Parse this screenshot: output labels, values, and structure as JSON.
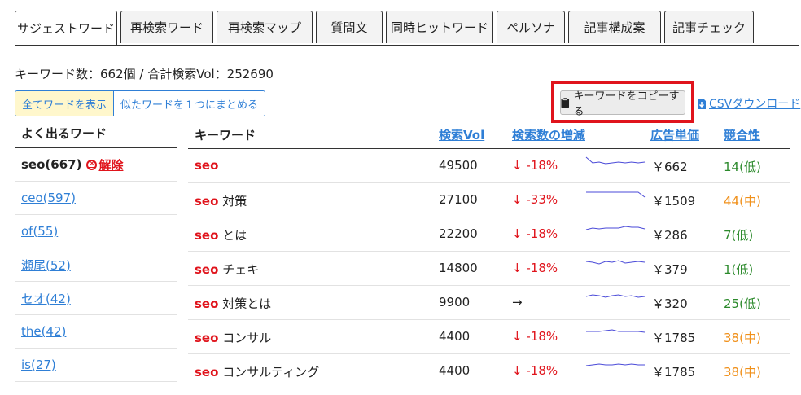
{
  "tabs": [
    "サジェストワード",
    "再検索ワード",
    "再検索マップ",
    "質問文",
    "同時ヒットワード",
    "ペルソナ",
    "記事構成案",
    "記事チェック"
  ],
  "summary": "キーワード数：662個 / 合計検索Vol：252690",
  "buttons": {
    "show_all": "全てワードを表示",
    "group_similar": "似たワードを１つにまとめる",
    "copy_keywords": "キーワードをコピーする",
    "csv_download": "CSVダウンロード"
  },
  "freq": {
    "header": "よく出るワード",
    "current": "seo(667)",
    "clear_label": "解除",
    "items": [
      "ceo(597)",
      "of(55)",
      "瀬尾(52)",
      "セオ(42)",
      "the(42)",
      "is(27)"
    ]
  },
  "table": {
    "headers": {
      "keyword": "キーワード",
      "volume": "検索Vol",
      "trend": "検索数の増減",
      "cpc": "広告単価",
      "competition": "競合性"
    },
    "accent": "#e0141c",
    "rows": [
      {
        "seo": "seo",
        "rest": "",
        "vol": "49500",
        "arrow": "↓",
        "change": "-18%",
        "cpc": "￥662",
        "comp": "14(低)",
        "level": "low",
        "spark": [
          2,
          9,
          8,
          10,
          9,
          8,
          9,
          8,
          9,
          8
        ]
      },
      {
        "seo": "seo",
        "rest": " 対策",
        "vol": "27100",
        "arrow": "↓",
        "change": "-33%",
        "cpc": "￥1509",
        "comp": "44(中)",
        "level": "mid",
        "spark": [
          3,
          3,
          3,
          3,
          3,
          3,
          3,
          3,
          3,
          9
        ]
      },
      {
        "seo": "seo",
        "rest": " とは",
        "vol": "22200",
        "arrow": "↓",
        "change": "-18%",
        "cpc": "￥286",
        "comp": "7(低)",
        "level": "low",
        "spark": [
          7,
          5,
          6,
          5,
          5,
          5,
          3,
          4,
          4,
          6
        ]
      },
      {
        "seo": "seo",
        "rest": " チェキ",
        "vol": "14800",
        "arrow": "↓",
        "change": "-18%",
        "cpc": "￥379",
        "comp": "1(低)",
        "level": "low",
        "spark": [
          4,
          5,
          7,
          4,
          5,
          3,
          6,
          5,
          4,
          5
        ]
      },
      {
        "seo": "seo",
        "rest": " 対策とは",
        "vol": "9900",
        "arrow": "→",
        "change": "",
        "cpc": "￥320",
        "comp": "25(低)",
        "level": "low",
        "spark": [
          5,
          3,
          4,
          6,
          4,
          3,
          5,
          4,
          6,
          5
        ]
      },
      {
        "seo": "seo",
        "rest": " コンサル",
        "vol": "4400",
        "arrow": "↓",
        "change": "-18%",
        "cpc": "￥1785",
        "comp": "38(中)",
        "level": "mid",
        "spark": [
          6,
          6,
          6,
          5,
          4,
          6,
          6,
          6,
          6,
          7
        ]
      },
      {
        "seo": "seo",
        "rest": " コンサルティング",
        "vol": "4400",
        "arrow": "↓",
        "change": "-18%",
        "cpc": "￥1785",
        "comp": "38(中)",
        "level": "mid",
        "spark": [
          6,
          5,
          4,
          5,
          5,
          4,
          5,
          4,
          5,
          5
        ]
      }
    ]
  }
}
